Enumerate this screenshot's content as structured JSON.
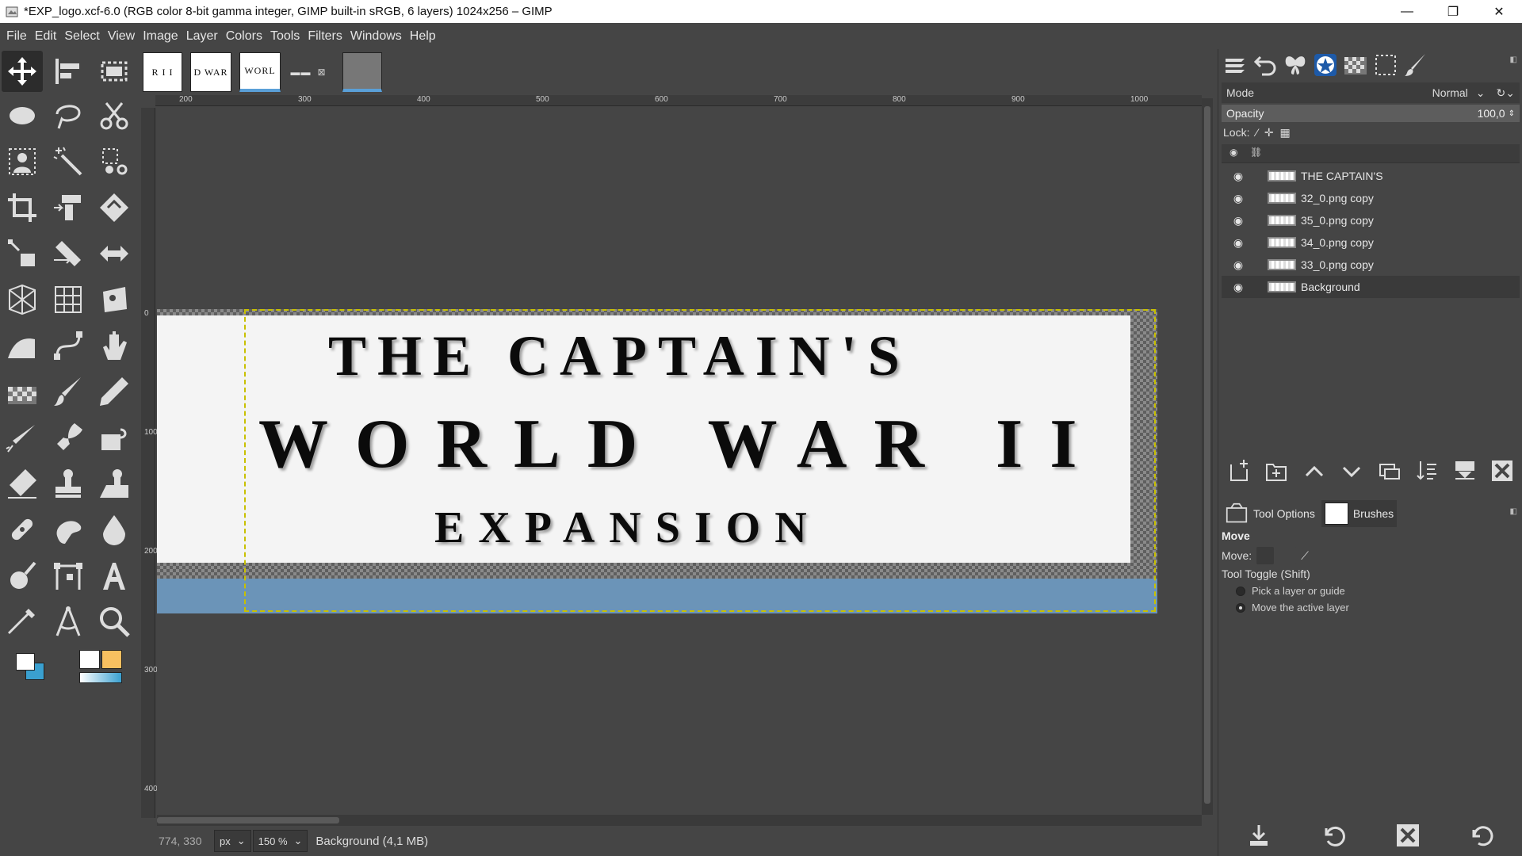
{
  "window": {
    "title": "*EXP_logo.xcf-6.0 (RGB color 8-bit gamma integer, GIMP built-in sRGB, 6 layers) 1024x256 – GIMP",
    "minimize_glyph": "—",
    "maximize_glyph": "❐",
    "close_glyph": "✕"
  },
  "menu": [
    "File",
    "Edit",
    "Select",
    "View",
    "Image",
    "Layer",
    "Colors",
    "Tools",
    "Filters",
    "Windows",
    "Help"
  ],
  "image_tabs": [
    {
      "label": "R I I"
    },
    {
      "label": "D WAR"
    },
    {
      "label": "WORL"
    },
    {
      "label": "▬▬"
    },
    {
      "label": ""
    }
  ],
  "ruler": {
    "top_labels": [
      "200",
      "300",
      "400",
      "500",
      "600",
      "700",
      "800",
      "900",
      "1000"
    ],
    "left_labels": [
      "0",
      "100",
      "200",
      "300",
      "400"
    ]
  },
  "canvas": {
    "line1": "THE CAPTAIN'S",
    "line2": "WORLD WAR II",
    "line3": "EXPANSION"
  },
  "statusbar": {
    "coords": "774, 330",
    "unit": "px",
    "zoom": "150 %",
    "info": "Background (4,1 MB)"
  },
  "layers_panel": {
    "mode_label": "Mode",
    "mode_value": "Normal",
    "opacity_label": "Opacity",
    "opacity_value": "100,0",
    "lock_label": "Lock:",
    "layers": [
      {
        "name": "THE CAPTAIN'S",
        "selected": false
      },
      {
        "name": "32_0.png copy",
        "selected": false
      },
      {
        "name": "35_0.png copy",
        "selected": false
      },
      {
        "name": "34_0.png copy",
        "selected": false
      },
      {
        "name": "33_0.png copy",
        "selected": false
      },
      {
        "name": "Background",
        "selected": true
      }
    ]
  },
  "tool_options": {
    "tab_tool_options": "Tool Options",
    "tab_brushes": "Brushes",
    "title": "Move",
    "move_label": "Move:",
    "toggle_label": "Tool Toggle  (Shift)",
    "option_pick": "Pick a layer or guide",
    "option_move": "Move the active layer"
  },
  "colors": {
    "accent": "#5aa0d8",
    "foreground": "#ffffff",
    "background": "#3aa0d0",
    "gradient_end": "#f8c060"
  }
}
